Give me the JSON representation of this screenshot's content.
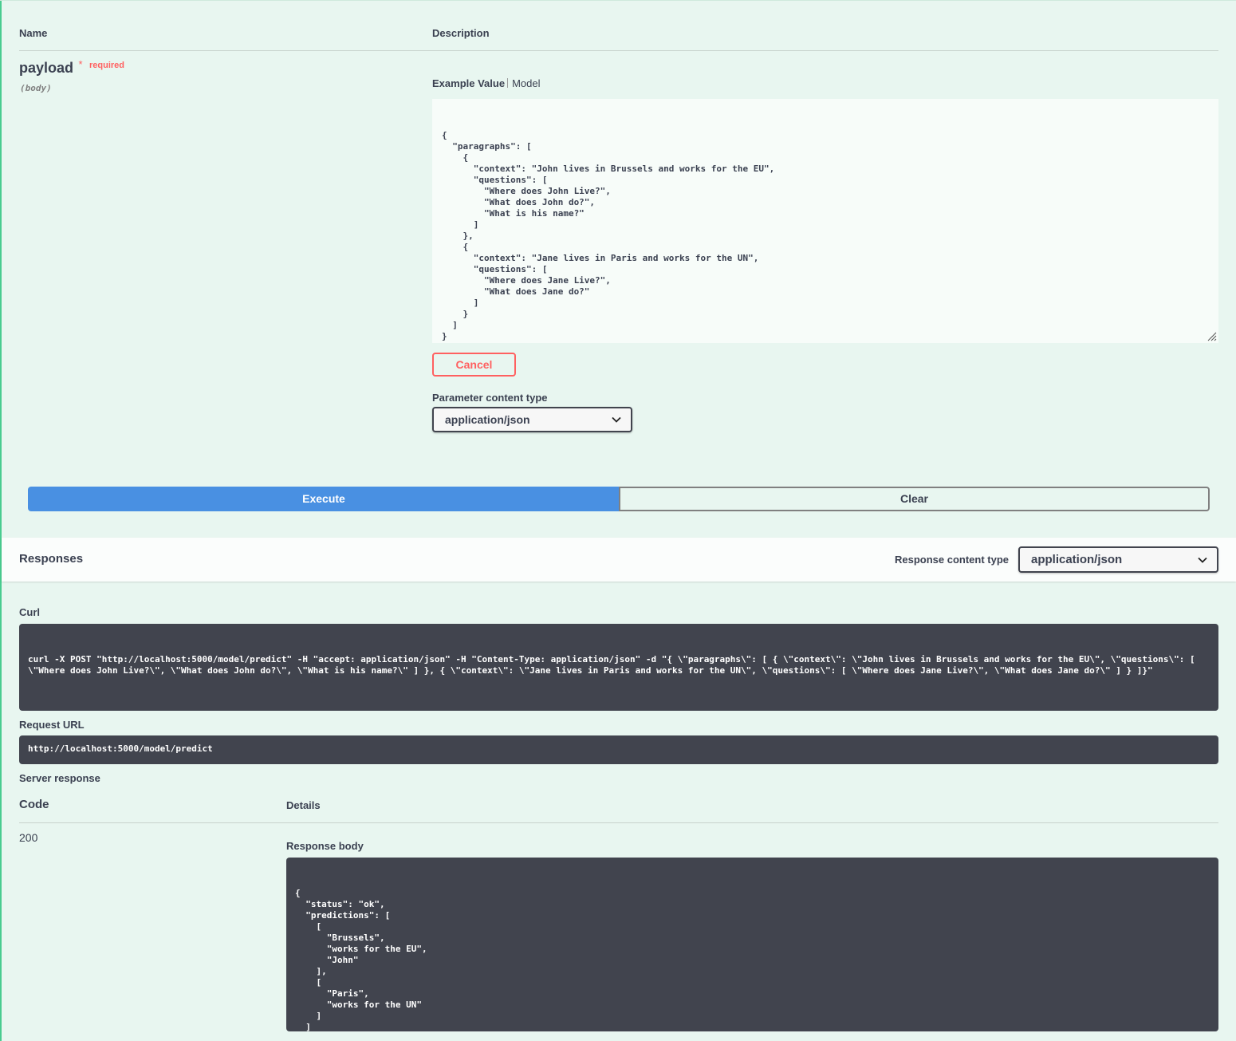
{
  "params": {
    "name_header": "Name",
    "description_header": "Description",
    "param_name": "payload",
    "required_star": "*",
    "required_label": "required",
    "param_type": "(body)",
    "example_value_tab": "Example Value",
    "model_tab": "Model",
    "body_json": "{\n  \"paragraphs\": [\n    {\n      \"context\": \"John lives in Brussels and works for the EU\",\n      \"questions\": [\n        \"Where does John Live?\",\n        \"What does John do?\",\n        \"What is his name?\"\n      ]\n    },\n    {\n      \"context\": \"Jane lives in Paris and works for the UN\",\n      \"questions\": [\n        \"Where does Jane Live?\",\n        \"What does Jane do?\"\n      ]\n    }\n  ]\n}",
    "cancel_label": "Cancel",
    "content_type_label": "Parameter content type",
    "content_type_value": "application/json"
  },
  "actions": {
    "execute_label": "Execute",
    "clear_label": "Clear"
  },
  "responses": {
    "title": "Responses",
    "content_type_label": "Response content type",
    "content_type_value": "application/json"
  },
  "result": {
    "curl_label": "Curl",
    "curl_command": "curl -X POST \"http://localhost:5000/model/predict\" -H \"accept: application/json\" -H \"Content-Type: application/json\" -d \"{ \\\"paragraphs\\\": [ { \\\"context\\\": \\\"John lives in Brussels and works for the EU\\\", \\\"questions\\\": [ \\\"Where does John Live?\\\", \\\"What does John do?\\\", \\\"What is his name?\\\" ] }, { \\\"context\\\": \\\"Jane lives in Paris and works for the UN\\\", \\\"questions\\\": [ \\\"Where does Jane Live?\\\", \\\"What does Jane do?\\\" ] } ]}\"",
    "request_url_label": "Request URL",
    "request_url": "http://localhost:5000/model/predict",
    "server_response_label": "Server response",
    "code_header": "Code",
    "details_header": "Details",
    "code": "200",
    "response_body_label": "Response body",
    "response_body": "{\n  \"status\": \"ok\",\n  \"predictions\": [\n    [\n      \"Brussels\",\n      \"works for the EU\",\n      \"John\"\n    ],\n    [\n      \"Paris\",\n      \"works for the UN\"\n    ]\n  ]\n}"
  },
  "colors": {
    "background": "#e8f6f0",
    "execute": "#4990e2",
    "cancel": "#ff6060",
    "dark_panel": "#41444e",
    "post_accent": "#49cc90"
  }
}
